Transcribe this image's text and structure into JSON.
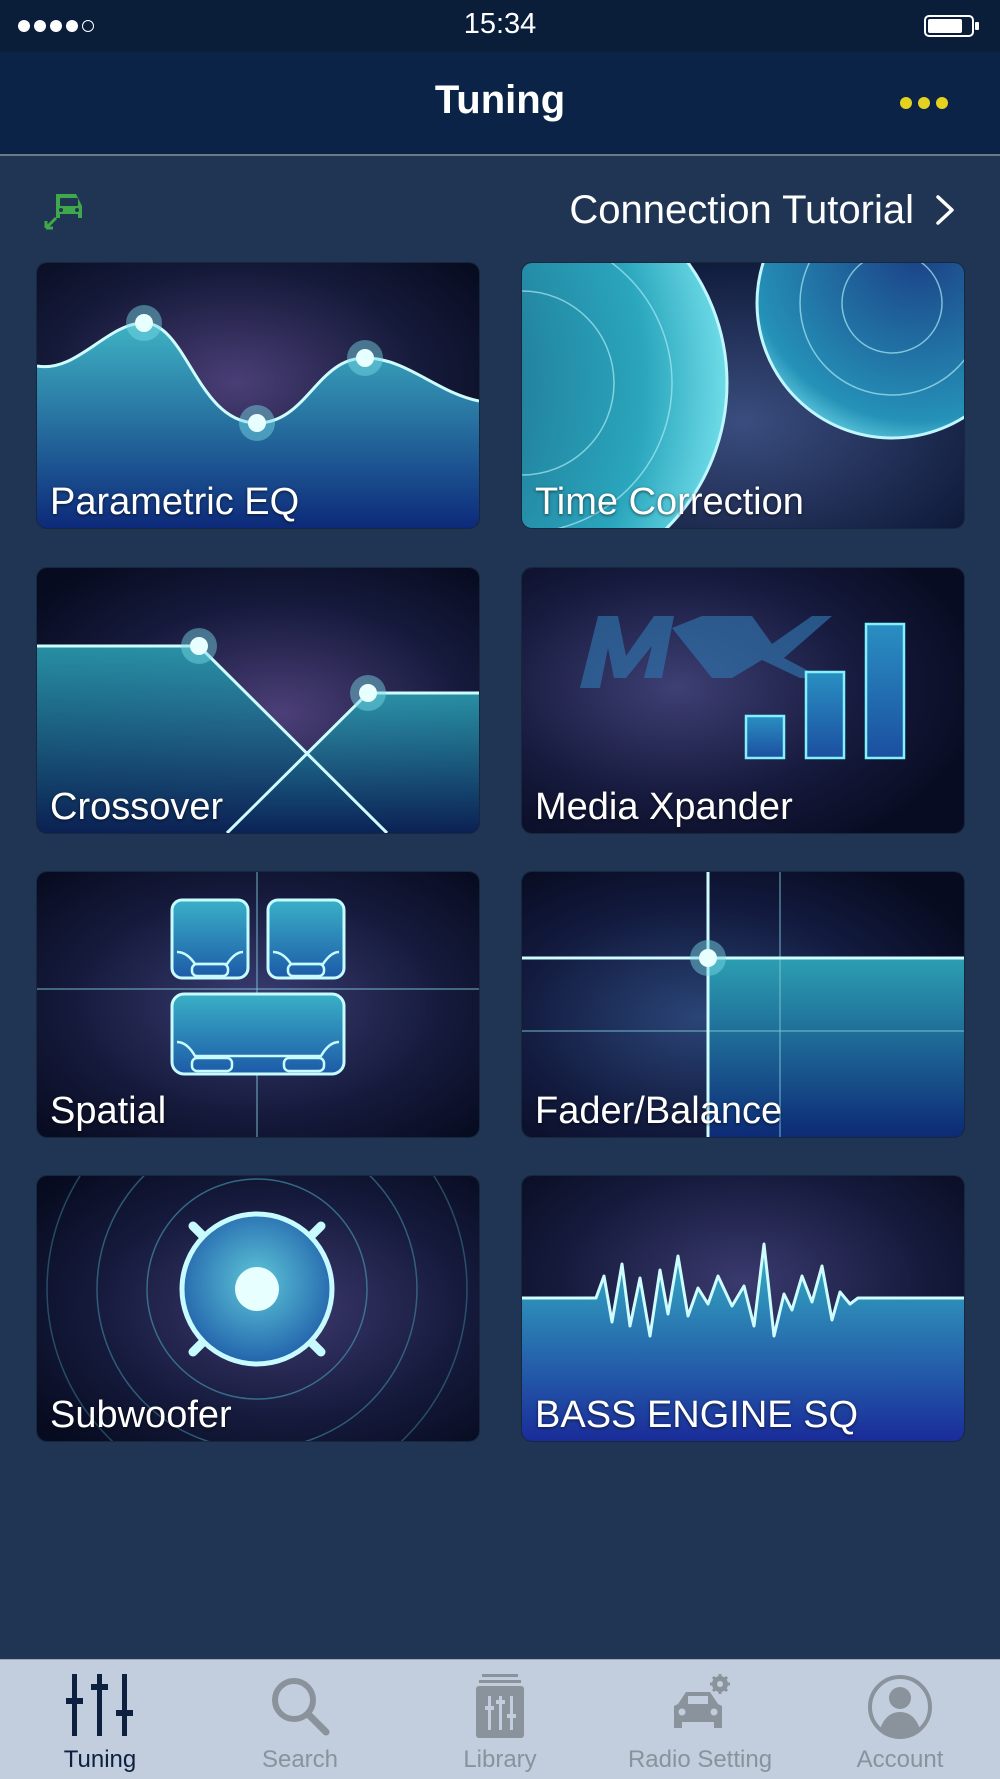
{
  "status_bar": {
    "time": "15:34"
  },
  "nav": {
    "title": "Tuning"
  },
  "connection": {
    "label": "Connection Tutorial"
  },
  "tiles": [
    {
      "label": "Parametric EQ"
    },
    {
      "label": "Time Correction"
    },
    {
      "label": "Crossover"
    },
    {
      "label": "Media Xpander"
    },
    {
      "label": "Spatial"
    },
    {
      "label": "Fader/Balance"
    },
    {
      "label": "Subwoofer"
    },
    {
      "label": "BASS ENGINE SQ"
    }
  ],
  "tabs": [
    {
      "label": "Tuning",
      "icon": "sliders-icon",
      "active": true
    },
    {
      "label": "Search",
      "icon": "search-icon",
      "active": false
    },
    {
      "label": "Library",
      "icon": "library-icon",
      "active": false
    },
    {
      "label": "Radio Setting",
      "icon": "car-gear-icon",
      "active": false
    },
    {
      "label": "Account",
      "icon": "account-icon",
      "active": false
    }
  ],
  "colors": {
    "background": "#1f3553",
    "nav_bar": "#0a2347",
    "accent_dots": "#e5d11f",
    "connection_icon": "#3fa84a",
    "tab_bar": "#c2cede",
    "tab_active": "#0e2040",
    "tab_inactive": "#8a929c"
  }
}
